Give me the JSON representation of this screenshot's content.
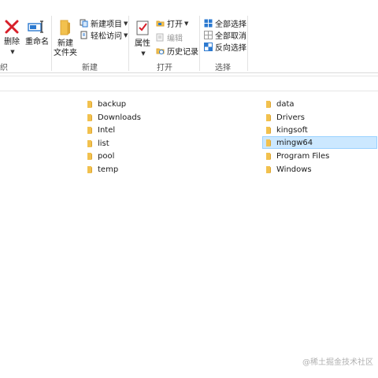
{
  "ribbon": {
    "left_group_label_partial": "织",
    "organize": {
      "delete_label": "删除",
      "rename_label": "重命名"
    },
    "new": {
      "new_folder_line1": "新建",
      "new_folder_line2": "文件夹",
      "new_item_label": "新建项目",
      "easy_access_label": "轻松访问",
      "group_label": "新建"
    },
    "open": {
      "properties_label": "属性",
      "open_label": "打开",
      "edit_label": "编辑",
      "history_label": "历史记录",
      "group_label": "打开"
    },
    "select": {
      "select_all_label": "全部选择",
      "select_none_label": "全部取消",
      "invert_label": "反向选择",
      "group_label": "选择"
    }
  },
  "files": {
    "left_column": [
      "backup",
      "Downloads",
      "Intel",
      "list",
      "pool",
      "temp"
    ],
    "right_column": [
      "data",
      "Drivers",
      "kingsoft",
      "mingw64",
      "Program Files",
      "Windows"
    ],
    "selected": "mingw64"
  },
  "colors": {
    "folder": "#f2c14e",
    "folder_dark": "#dca534",
    "selection_bg": "#cce8ff",
    "delete_red": "#d8202a",
    "accent_blue": "#2b79d0"
  },
  "watermark": "@稀土掘金技术社区"
}
